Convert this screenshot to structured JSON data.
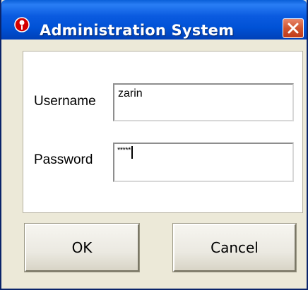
{
  "window": {
    "title": "Administration System"
  },
  "icons": {
    "app": "app-icon",
    "close": "close-icon"
  },
  "form": {
    "username_label": "Username",
    "username_value": "zarin",
    "password_label": "Password",
    "password_value": "*****"
  },
  "buttons": {
    "ok_label": "OK",
    "cancel_label": "Cancel"
  },
  "colors": {
    "titlebar": "#0052d6",
    "close_button": "#d0542f",
    "window_background": "#ece9d8"
  }
}
